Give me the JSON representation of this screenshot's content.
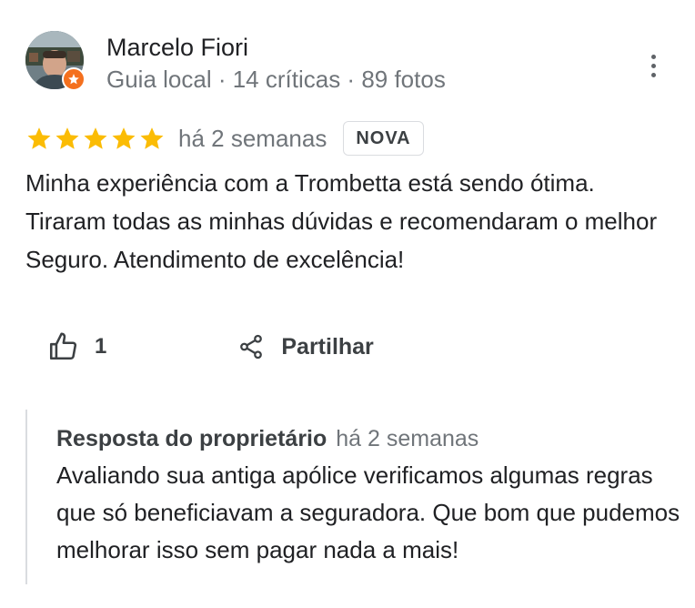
{
  "reviewer": {
    "name": "Marcelo Fiori",
    "meta": "Guia local · 14 críticas · 89 fotos"
  },
  "review": {
    "rating": 5,
    "max_rating": 5,
    "date": "há 2 semanas",
    "badge": "NOVA",
    "text": "Minha experiência com a Trombetta está sendo ótima. Tiraram todas as minhas dúvidas e recomendaram o melhor Seguro. Atendimento de excelência!"
  },
  "actions": {
    "like_count": "1",
    "share_label": "Partilhar"
  },
  "owner_reply": {
    "title": "Resposta do proprietário",
    "date": "há 2 semanas",
    "text": "Avaliando sua antiga apólice verificamos algumas regras que só beneficiavam a seguradora. Que bom que pudemos melhorar isso sem pagar nada a mais!"
  },
  "colors": {
    "star": "#fbbc04",
    "local_guide_badge": "#f4701e",
    "secondary_text": "#70757a"
  },
  "icons": [
    "local-guide-star-icon",
    "more-vert-icon",
    "star-icon",
    "thumb-up-icon",
    "share-icon"
  ]
}
